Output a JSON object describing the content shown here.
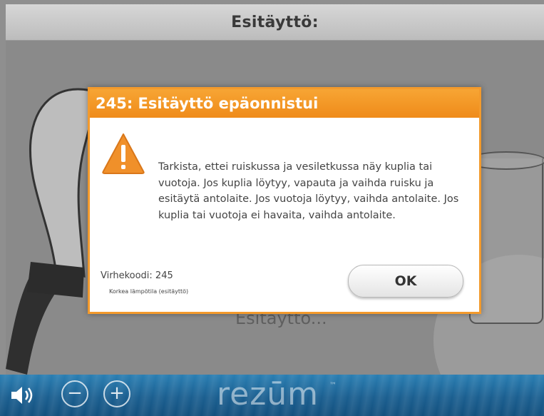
{
  "screen": {
    "title": "Esitäyttö:",
    "background_status": "Esitäyttö..."
  },
  "dialog": {
    "title": "245: Esitäyttö epäonnistui",
    "message": "Tarkista, ettei ruiskussa ja vesiletkussa näy kuplia tai vuotoja. Jos kuplia löytyy, vapauta ja vaihda ruisku ja esitäytä antolaite. Jos vuotoja löytyy, vaihda antolaite. Jos kuplia tai vuotoja ei havaita, vaihda antolaite.",
    "error_code": "Virhekoodi: 245",
    "error_detail": "Korkea lämpötila (esitäyttö)",
    "ok_label": "OK",
    "icon": "warning-icon"
  },
  "bottombar": {
    "brand": "rezūm",
    "brand_mark": "™",
    "volume_icon": "speaker-icon",
    "volume_down_label": "−",
    "volume_up_label": "+"
  },
  "colors": {
    "dialog_accent": "#f39a2c",
    "titlebar": "#c9c9c9",
    "bottombar": "#1b5f90"
  }
}
